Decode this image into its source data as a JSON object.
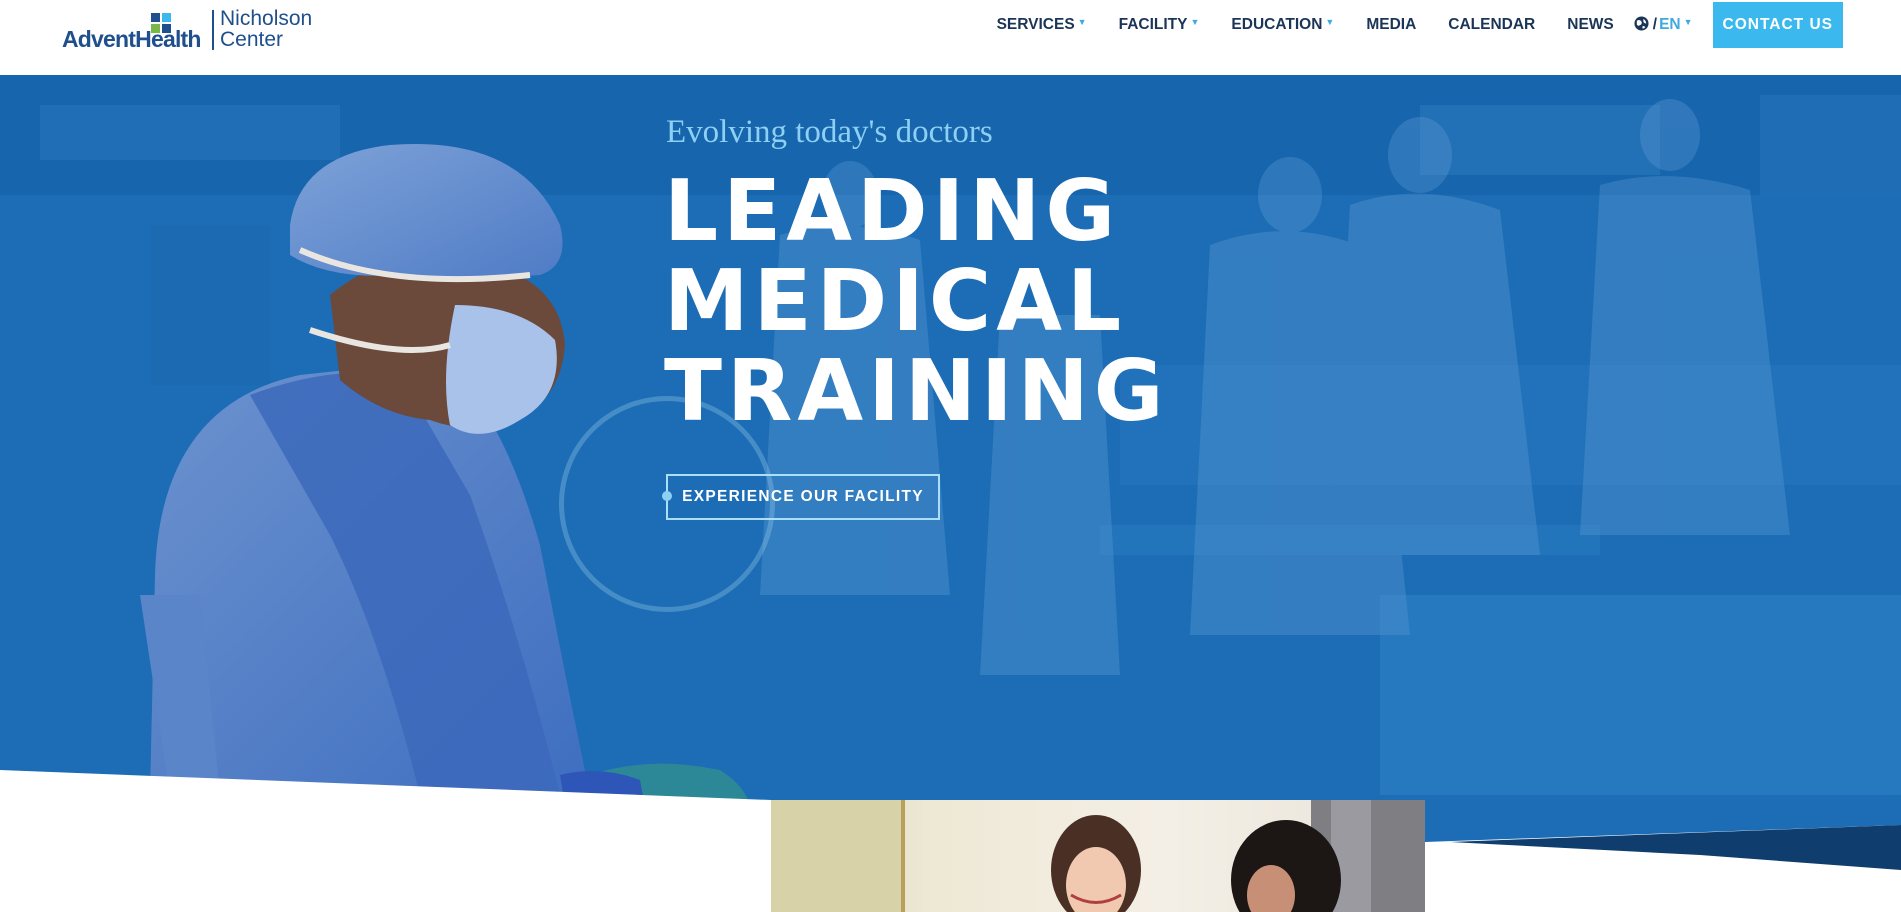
{
  "brand": {
    "name_left": "AdventHealth",
    "name_right_line1": "Nicholson",
    "name_right_line2": "Center"
  },
  "nav": {
    "items": [
      {
        "label": "SERVICES",
        "has_caret": true
      },
      {
        "label": "FACILITY",
        "has_caret": true
      },
      {
        "label": "EDUCATION",
        "has_caret": true
      },
      {
        "label": "MEDIA",
        "has_caret": false
      },
      {
        "label": "CALENDAR",
        "has_caret": false
      },
      {
        "label": "NEWS",
        "has_caret": false
      }
    ],
    "language": {
      "slash": "/",
      "code": "EN",
      "icon": "globe-icon"
    },
    "contact_label": "CONTACT US"
  },
  "hero": {
    "tagline": "Evolving today's doctors",
    "headline_lines": [
      "LEADING",
      "MEDICAL",
      "TRAINING"
    ],
    "cta_label": "EXPERIENCE OUR FACILITY"
  },
  "colors": {
    "brand_navy": "#1b3557",
    "accent_blue": "#3bb9ef",
    "hero_blue": "#1d73ba"
  }
}
